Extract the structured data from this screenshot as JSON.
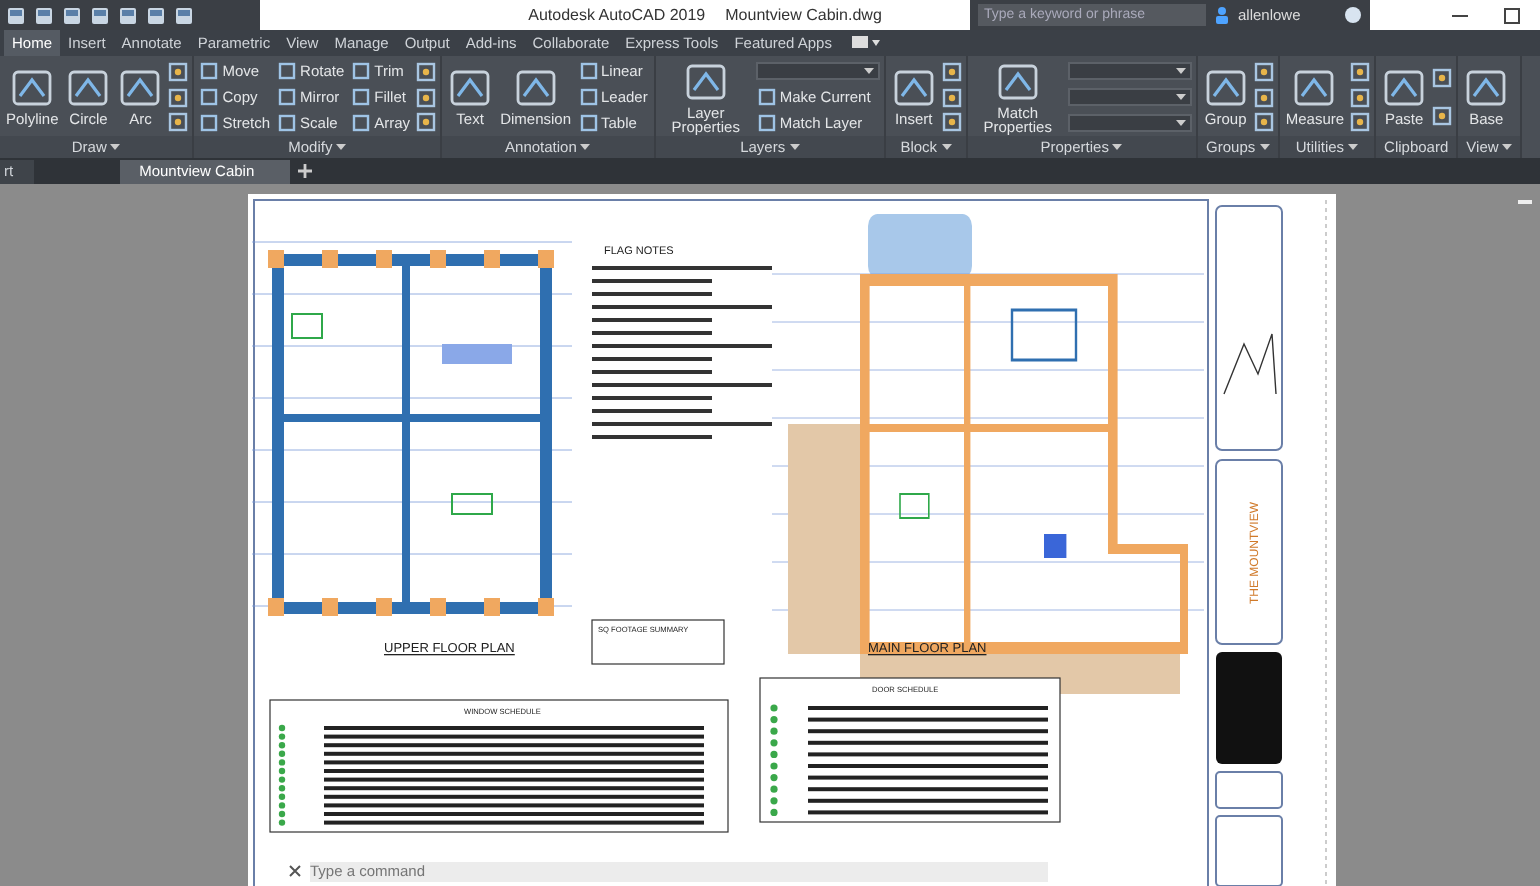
{
  "title_bar": {
    "app_title": "Autodesk AutoCAD 2019",
    "file_name": "Mountview Cabin.dwg",
    "search_placeholder": "Type a keyword or phrase",
    "user": "allenlowe"
  },
  "ribbon_tabs": [
    {
      "label": "Home",
      "selected": true
    },
    {
      "label": "Insert",
      "selected": false
    },
    {
      "label": "Annotate",
      "selected": false
    },
    {
      "label": "Parametric",
      "selected": false
    },
    {
      "label": "View",
      "selected": false
    },
    {
      "label": "Manage",
      "selected": false
    },
    {
      "label": "Output",
      "selected": false
    },
    {
      "label": "Add-ins",
      "selected": false
    },
    {
      "label": "Collaborate",
      "selected": false
    },
    {
      "label": "Express Tools",
      "selected": false
    },
    {
      "label": "Featured Apps",
      "selected": false
    }
  ],
  "panels": [
    {
      "label": "Draw",
      "menu": true,
      "columns": [
        [
          {
            "kind": "large",
            "label": "Polyline"
          }
        ],
        [
          {
            "kind": "large",
            "label": "Circle"
          }
        ],
        [
          {
            "kind": "large",
            "label": "Arc"
          }
        ],
        [
          {
            "kind": "icon"
          },
          {
            "kind": "icon"
          },
          {
            "kind": "icon"
          }
        ]
      ]
    },
    {
      "label": "Modify",
      "menu": true,
      "columns": [
        [
          {
            "kind": "small",
            "label": "Move"
          },
          {
            "kind": "small",
            "label": "Copy"
          },
          {
            "kind": "small",
            "label": "Stretch"
          }
        ],
        [
          {
            "kind": "small",
            "label": "Rotate"
          },
          {
            "kind": "small",
            "label": "Mirror"
          },
          {
            "kind": "small",
            "label": "Scale"
          }
        ],
        [
          {
            "kind": "small",
            "label": "Trim"
          },
          {
            "kind": "small",
            "label": "Fillet"
          },
          {
            "kind": "small",
            "label": "Array"
          }
        ],
        [
          {
            "kind": "icon"
          },
          {
            "kind": "icon"
          },
          {
            "kind": "icon"
          }
        ]
      ]
    },
    {
      "label": "Annotation",
      "menu": true,
      "columns": [
        [
          {
            "kind": "large",
            "label": "Text"
          }
        ],
        [
          {
            "kind": "large",
            "label": "Dimension"
          }
        ],
        [
          {
            "kind": "small",
            "label": "Linear"
          },
          {
            "kind": "small",
            "label": "Leader"
          },
          {
            "kind": "small",
            "label": "Table"
          }
        ]
      ]
    },
    {
      "label": "Layers",
      "menu": true,
      "columns": [
        [
          {
            "kind": "large",
            "label": "Layer Properties"
          }
        ],
        [
          {
            "kind": "dropdown"
          },
          {
            "kind": "small",
            "label": "Make Current"
          },
          {
            "kind": "small",
            "label": "Match Layer"
          }
        ]
      ]
    },
    {
      "label": "Block",
      "menu": true,
      "columns": [
        [
          {
            "kind": "large",
            "label": "Insert"
          }
        ],
        [
          {
            "kind": "icon"
          },
          {
            "kind": "icon"
          },
          {
            "kind": "icon"
          }
        ]
      ]
    },
    {
      "label": "Properties",
      "menu": true,
      "columns": [
        [
          {
            "kind": "large",
            "label": "Match Properties"
          }
        ],
        [
          {
            "kind": "dropdown"
          },
          {
            "kind": "dropdown"
          },
          {
            "kind": "dropdown"
          }
        ]
      ]
    },
    {
      "label": "Groups",
      "menu": true,
      "columns": [
        [
          {
            "kind": "large",
            "label": "Group"
          }
        ],
        [
          {
            "kind": "icon"
          },
          {
            "kind": "icon"
          },
          {
            "kind": "icon"
          }
        ]
      ]
    },
    {
      "label": "Utilities",
      "menu": true,
      "columns": [
        [
          {
            "kind": "large",
            "label": "Measure"
          }
        ],
        [
          {
            "kind": "icon"
          },
          {
            "kind": "icon"
          },
          {
            "kind": "icon"
          }
        ]
      ]
    },
    {
      "label": "Clipboard",
      "menu": false,
      "columns": [
        [
          {
            "kind": "large",
            "label": "Paste"
          }
        ],
        [
          {
            "kind": "icon"
          },
          {
            "kind": "icon"
          }
        ]
      ]
    },
    {
      "label": "View",
      "menu": true,
      "columns": [
        [
          {
            "kind": "large",
            "label": "Base"
          }
        ]
      ]
    }
  ],
  "doc_tabs": [
    {
      "label": "rt",
      "selected": false
    },
    {
      "label": "Mountview Cabin",
      "selected": true
    }
  ],
  "sheet": {
    "flag_notes_title": "FLAG NOTES",
    "upper_plan_title": "UPPER FLOOR PLAN",
    "main_plan_title": "MAIN FLOOR PLAN",
    "sq_footage_title": "SQ FOOTAGE SUMMARY",
    "window_schedule_title": "WINDOW SCHEDULE",
    "door_schedule_title": "DOOR SCHEDULE",
    "project_name": "THE MOUNTVIEW"
  },
  "command_line": {
    "placeholder": "Type a command"
  }
}
